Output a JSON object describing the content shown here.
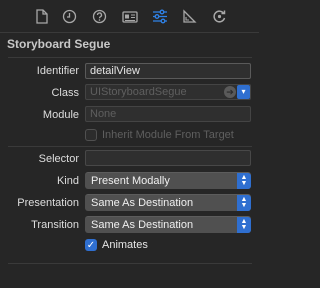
{
  "inspector_tabs": [
    {
      "icon": "file-icon"
    },
    {
      "icon": "history-clock-icon"
    },
    {
      "icon": "help-question-icon"
    },
    {
      "icon": "identity-card-icon"
    },
    {
      "icon": "attributes-sliders-icon",
      "selected": true
    },
    {
      "icon": "size-ruler-icon"
    },
    {
      "icon": "connections-arrow-icon"
    }
  ],
  "accent_color": "#2F6FD0",
  "section": {
    "title": "Storyboard Segue"
  },
  "fields": {
    "identifier": {
      "label": "Identifier",
      "value": "detailView"
    },
    "class": {
      "label": "Class",
      "placeholder": "UIStoryboardSegue"
    },
    "module": {
      "label": "Module",
      "placeholder": "None"
    },
    "inherit": {
      "label": "Inherit Module From Target",
      "checked": false,
      "enabled": false
    },
    "selector": {
      "label": "Selector",
      "value": ""
    },
    "kind": {
      "label": "Kind",
      "value": "Present Modally"
    },
    "presentation": {
      "label": "Presentation",
      "value": "Same As Destination"
    },
    "transition": {
      "label": "Transition",
      "value": "Same As Destination"
    },
    "animates": {
      "label": "Animates",
      "checked": true
    }
  }
}
